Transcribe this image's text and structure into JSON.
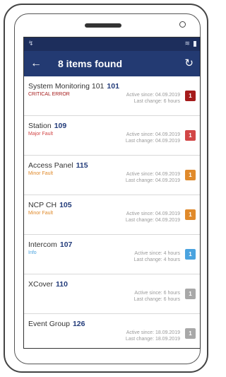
{
  "statusbar": {
    "left_glyph": "↯",
    "wifi": "≋"
  },
  "appbar": {
    "back_icon": "←",
    "title": "8 items found",
    "refresh_icon": "↻"
  },
  "colors": {
    "statusbar_bg": "#1d2e5c",
    "appbar_bg": "#233a72",
    "critical": "#a51b1b",
    "major": "#d24646",
    "minor": "#e08a2b",
    "info": "#4aa3df",
    "none": "#a8a8a8"
  },
  "items": [
    {
      "name": "System Monitoring 101",
      "number": "101",
      "severity": "CRITICAL ERROR",
      "severity_color": "#a51b1b",
      "active_since": "Active since: 04.09.2019",
      "last_change": "Last change: 6 hours",
      "badge": "1",
      "badge_color": "#a51b1b"
    },
    {
      "name": "Station",
      "number": "109",
      "severity": "Major Fault",
      "severity_color": "#d24646",
      "active_since": "Active since: 04.09.2019",
      "last_change": "Last change: 04.09.2019",
      "badge": "1",
      "badge_color": "#d24646"
    },
    {
      "name": "Access Panel",
      "number": "115",
      "severity": "Minor Fault",
      "severity_color": "#e08a2b",
      "active_since": "Active since: 04.09.2019",
      "last_change": "Last change: 04.09.2019",
      "badge": "1",
      "badge_color": "#e08a2b"
    },
    {
      "name": "NCP CH",
      "number": "105",
      "severity": "Minor Fault",
      "severity_color": "#e08a2b",
      "active_since": "Active since: 04.09.2019",
      "last_change": "Last change: 04.09.2019",
      "badge": "1",
      "badge_color": "#e08a2b"
    },
    {
      "name": "Intercom",
      "number": "107",
      "severity": "Info",
      "severity_color": "#4aa3df",
      "active_since": "Active since: 4 hours",
      "last_change": "Last change: 4 hours",
      "badge": "1",
      "badge_color": "#4aa3df"
    },
    {
      "name": "XCover",
      "number": "110",
      "severity": "",
      "severity_color": "#a8a8a8",
      "active_since": "Active since: 6 hours",
      "last_change": "Last change: 6 hours",
      "badge": "1",
      "badge_color": "#a8a8a8"
    },
    {
      "name": "Event Group",
      "number": "126",
      "severity": "",
      "severity_color": "#a8a8a8",
      "active_since": "Active since: 18.09.2019",
      "last_change": "Last change: 18.09.2019",
      "badge": "1",
      "badge_color": "#a8a8a8"
    }
  ]
}
